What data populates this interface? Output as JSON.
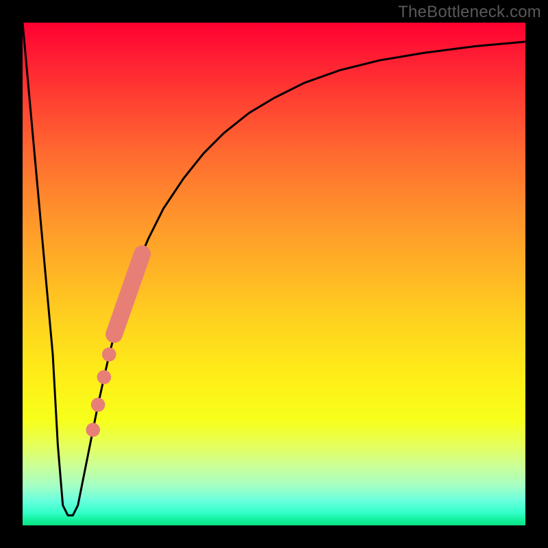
{
  "watermark": "TheBottleneck.com",
  "colors": {
    "curve": "#000000",
    "marker": "#e87f76",
    "frame": "#000000"
  },
  "chart_data": {
    "type": "line",
    "title": "",
    "xlabel": "",
    "ylabel": "",
    "xlim": [
      0,
      100
    ],
    "ylim": [
      0,
      100
    ],
    "grid": false,
    "series": [
      {
        "name": "bottleneck-curve",
        "x": [
          0,
          2,
          4,
          6,
          7,
          8,
          9,
          10,
          11,
          13,
          15,
          17,
          19,
          22,
          25,
          28,
          32,
          36,
          40,
          45,
          50,
          56,
          63,
          71,
          80,
          90,
          100
        ],
        "y": [
          100,
          78,
          56,
          34,
          16,
          4,
          2,
          2,
          4,
          14,
          24,
          33,
          41,
          50,
          57,
          63,
          69,
          74,
          78,
          82,
          85,
          88,
          90.5,
          92.5,
          94,
          95.3,
          96.2
        ]
      }
    ],
    "markers": {
      "name": "highlighted-points",
      "points": [
        {
          "x": 14.0,
          "y": 19.0,
          "r": 1.4
        },
        {
          "x": 15.0,
          "y": 24.0,
          "r": 1.4
        },
        {
          "x": 16.2,
          "y": 29.5,
          "r": 1.4
        },
        {
          "x": 17.2,
          "y": 34.0,
          "r": 1.4
        }
      ],
      "bar": {
        "x1": 18.2,
        "y1": 38.0,
        "x2": 23.8,
        "y2": 54.0,
        "thickness": 3.4
      }
    }
  }
}
